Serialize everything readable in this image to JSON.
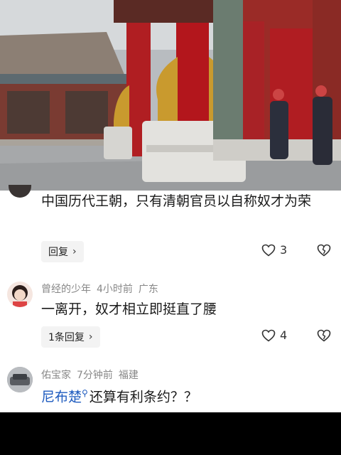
{
  "video": {
    "scene": "palace courtyard scene with guards"
  },
  "comments": [
    {
      "text": "中国历代王朝，只有清朝官员以自称奴才为荣",
      "reply_label": "回复",
      "likes": "3"
    },
    {
      "username": "曾经的少年",
      "time": "4小时前",
      "location": "广东",
      "text": "一离开，奴才相立即挺直了腰",
      "reply_label": "1条回复",
      "likes": "4"
    },
    {
      "username": "佑宝家",
      "time": "7分钟前",
      "location": "福建",
      "link_text": "尼布楚",
      "text_rest": "还算有利条约？？"
    }
  ],
  "colors": {
    "link": "#1e5bbf",
    "meta": "#888888",
    "reply_bg": "#f3f3f3"
  },
  "icons": {
    "chevron": "›",
    "like": "heart-outline-icon",
    "dislike": "broken-heart-icon",
    "search": "search-icon"
  }
}
